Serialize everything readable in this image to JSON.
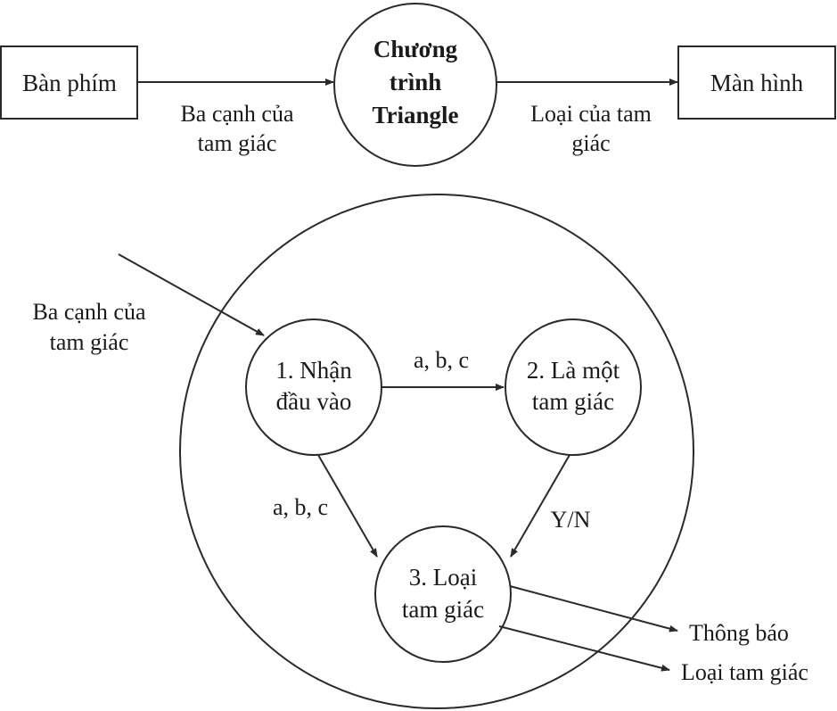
{
  "top": {
    "source_label": "Bàn phím",
    "process_lines": [
      "Chương",
      "trình",
      "Triangle"
    ],
    "sink_label": "Màn hình",
    "input_flow_lines": [
      "Ba cạnh của",
      "tam giác"
    ],
    "output_flow_lines": [
      "Loại của tam",
      "giác"
    ]
  },
  "detail": {
    "external_input_lines": [
      "Ba cạnh của",
      "tam giác"
    ],
    "process1_lines": [
      "1. Nhận",
      "đầu vào"
    ],
    "process2_lines": [
      "2. Là một",
      "tam giác"
    ],
    "process3_lines": [
      "3. Loại",
      "tam giác"
    ],
    "flow_1_to_2": "a, b, c",
    "flow_1_to_3": "a, b, c",
    "flow_2_to_3": "Y/N",
    "output_message": "Thông báo",
    "output_type": "Loại tam giác"
  },
  "colors": {
    "stroke": "#2a2a2a",
    "text": "#1a1a1a",
    "background": "#ffffff"
  }
}
